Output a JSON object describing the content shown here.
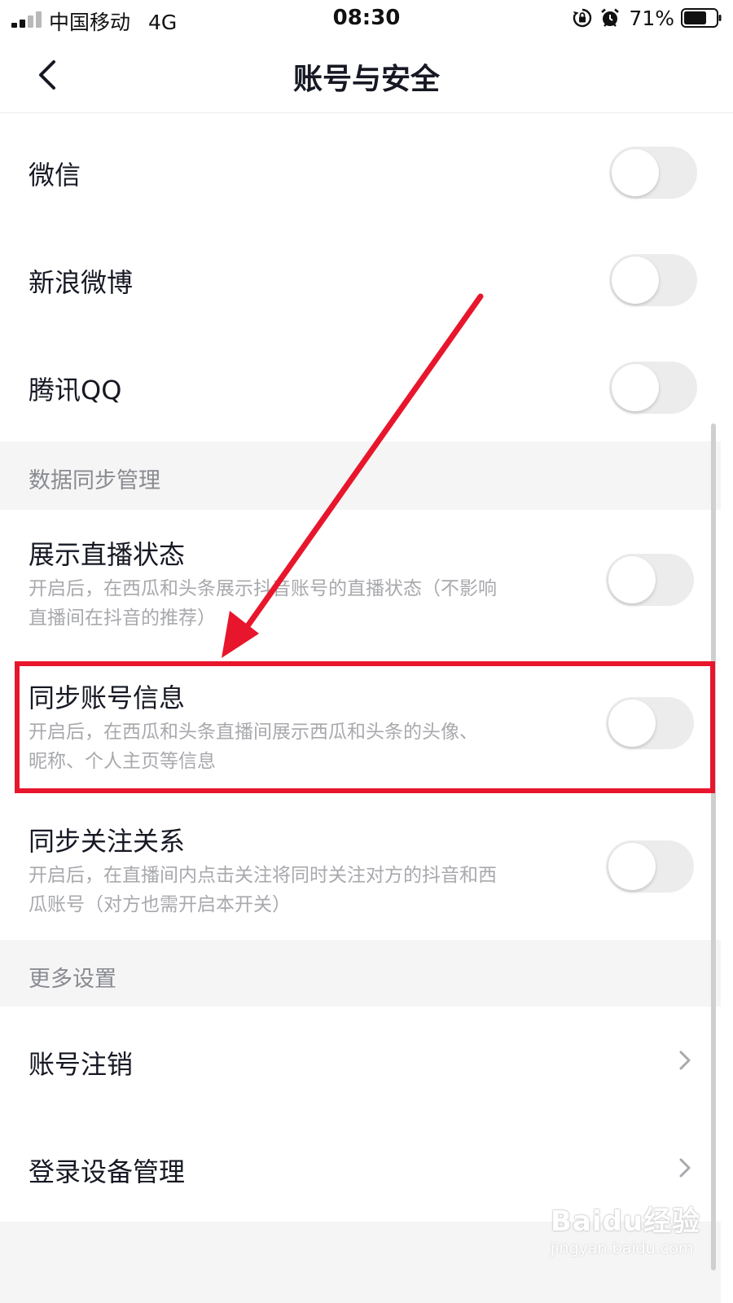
{
  "status_bar": {
    "carrier": "中国移动",
    "network": "4G",
    "time": "08:30",
    "battery_percent": "71%",
    "battery_level": 0.71,
    "icons": [
      "signal-icon",
      "rotation-lock-icon",
      "alarm-icon",
      "battery-icon"
    ]
  },
  "nav": {
    "title": "账号与安全",
    "back_icon": "chevron-left-icon"
  },
  "bindings": [
    {
      "label": "微信",
      "enabled": false
    },
    {
      "label": "新浪微博",
      "enabled": false
    },
    {
      "label": "腾讯QQ",
      "enabled": false
    }
  ],
  "sections": {
    "data_sync": {
      "header": "数据同步管理",
      "items": [
        {
          "label": "展示直播状态",
          "desc1": "开启后，在西瓜和头条展示抖音账号的直播状态（不影响",
          "desc2": "直播间在抖音的推荐）",
          "enabled": false
        },
        {
          "label": "同步账号信息",
          "desc1": "开启后，在西瓜和头条直播间展示西瓜和头条的头像、",
          "desc2": "昵称、个人主页等信息",
          "enabled": false
        },
        {
          "label": "同步关注关系",
          "desc1": "开启后，在直播间内点击关注将同时关注对方的抖音和西",
          "desc2": "瓜账号（对方也需开启本开关）",
          "enabled": false
        }
      ]
    },
    "more": {
      "header": "更多设置",
      "items": [
        {
          "label": "账号注销"
        },
        {
          "label": "登录设备管理"
        }
      ]
    }
  },
  "annotation": {
    "highlight_color": "#e8162c",
    "target": "同步账号信息"
  },
  "watermark": {
    "logo": "Baidu经验",
    "url": "jingyan.baidu.com"
  },
  "colors": {
    "toggle_off": "#ececec",
    "section_bg": "#f5f5f5",
    "primary_text": "#161823",
    "secondary_text": "#a8a9ad"
  }
}
